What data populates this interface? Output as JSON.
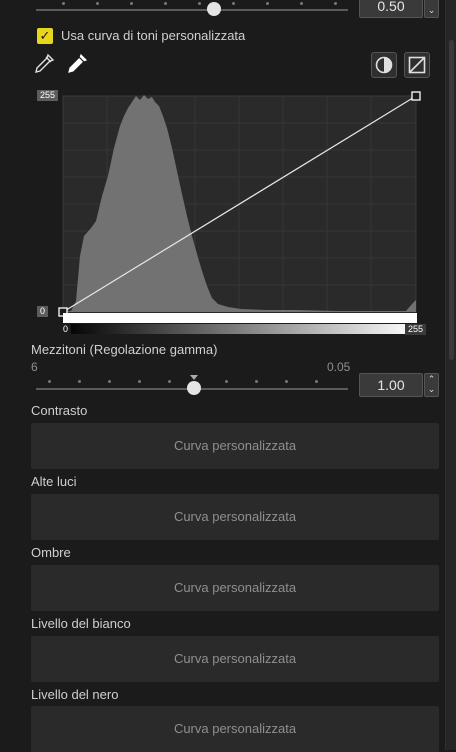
{
  "top_slider": {
    "value": "0.50",
    "level": 0.5
  },
  "custom_curve_checkbox": {
    "label": "Usa curva di toni personalizzata",
    "checked": true
  },
  "curve": {
    "max_tag": "255",
    "min_tag": "0",
    "gradient_min": "0",
    "gradient_max": "255",
    "points": [
      [
        0,
        0
      ],
      [
        255,
        255
      ]
    ]
  },
  "midtones": {
    "label": "Mezzitoni (Regolazione gamma)",
    "range_min": "6",
    "range_max": "0.05",
    "value": "1.00"
  },
  "sections": [
    {
      "label": "Contrasto",
      "button": "Curva personalizzata"
    },
    {
      "label": "Alte luci",
      "button": "Curva personalizzata"
    },
    {
      "label": "Ombre",
      "button": "Curva personalizzata"
    },
    {
      "label": "Livello del bianco",
      "button": "Curva personalizzata"
    },
    {
      "label": "Livello del nero",
      "button": "Curva personalizzata"
    }
  ],
  "icons": {
    "eyedropper_black": "eyedropper-icon",
    "eyedropper_white": "eyedropper-icon",
    "contrast": "contrast-icon",
    "reset_curve": "linear-curve-icon"
  }
}
